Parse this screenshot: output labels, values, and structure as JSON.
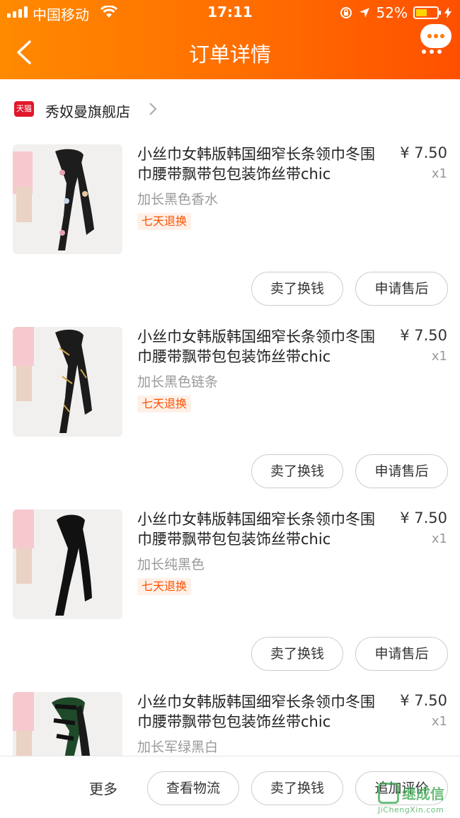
{
  "status_bar": {
    "carrier": "中国移动",
    "time": "17:11",
    "battery": "52%",
    "battery_level": 0.52
  },
  "header": {
    "title": "订单详情"
  },
  "shop": {
    "badge": "天猫",
    "name": "秀奴曼旗舰店"
  },
  "items": [
    {
      "name": "小丝巾女韩版韩国细窄长条领巾冬围巾腰带飘带包包装饰丝带chic",
      "variant": "加长黑色香水",
      "price": "¥ 7.50",
      "qty": "x1",
      "tag": "七天退换",
      "btn_sell": "卖了换钱",
      "btn_after": "申请售后"
    },
    {
      "name": "小丝巾女韩版韩国细窄长条领巾冬围巾腰带飘带包包装饰丝带chic",
      "variant": "加长黑色链条",
      "price": "¥ 7.50",
      "qty": "x1",
      "tag": "七天退换",
      "btn_sell": "卖了换钱",
      "btn_after": "申请售后"
    },
    {
      "name": "小丝巾女韩版韩国细窄长条领巾冬围巾腰带飘带包包装饰丝带chic",
      "variant": "加长纯黑色",
      "price": "¥ 7.50",
      "qty": "x1",
      "tag": "七天退换",
      "btn_sell": "卖了换钱",
      "btn_after": "申请售后"
    },
    {
      "name": "小丝巾女韩版韩国细窄长条领巾冬围巾腰带飘带包包装饰丝带chic",
      "variant": "加长军绿黑白",
      "price": "¥ 7.50",
      "qty": "x1"
    }
  ],
  "bottom_bar": {
    "more": "更多",
    "logistics": "查看物流",
    "sell": "卖了换钱",
    "review": "追加评价"
  },
  "watermark": {
    "text": "继成信",
    "url": "JiChengXin.com"
  },
  "colors": {
    "accent": "#ff5000",
    "header_start": "#ff8a00",
    "header_end": "#ff5000"
  }
}
